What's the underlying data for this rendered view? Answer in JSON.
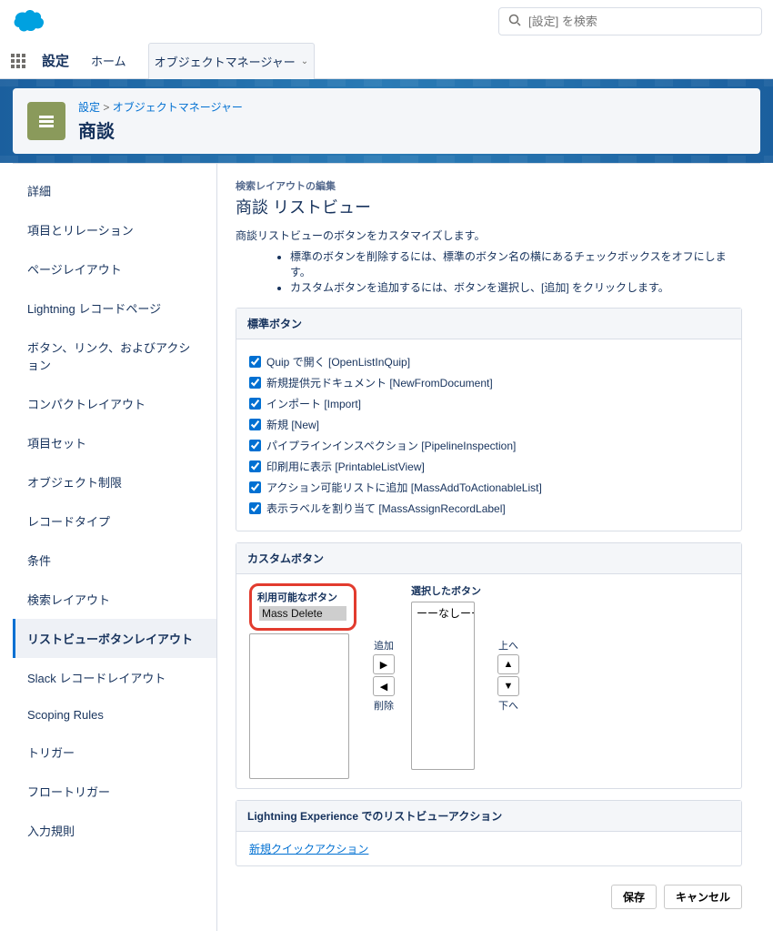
{
  "search": {
    "placeholder": "[設定] を検索"
  },
  "nav": {
    "title": "設定",
    "home": "ホーム",
    "objmgr": "オブジェクトマネージャー"
  },
  "breadcrumb": {
    "a": "設定",
    "b": "オブジェクトマネージャー"
  },
  "page": {
    "title": "商談"
  },
  "sidebar": {
    "items": [
      "詳細",
      "項目とリレーション",
      "ページレイアウト",
      "Lightning レコードページ",
      "ボタン、リンク、およびアクション",
      "コンパクトレイアウト",
      "項目セット",
      "オブジェクト制限",
      "レコードタイプ",
      "条件",
      "検索レイアウト",
      "リストビューボタンレイアウト",
      "Slack レコードレイアウト",
      "Scoping Rules",
      "トリガー",
      "フロートリガー",
      "入力規則"
    ],
    "activeIndex": 11
  },
  "main": {
    "edit_label": "検索レイアウトの編集",
    "title": "商談 リストビュー",
    "desc": "商談リストビューのボタンをカスタマイズします。",
    "hints": [
      "標準のボタンを削除するには、標準のボタン名の横にあるチェックボックスをオフにします。",
      "カスタムボタンを追加するには、ボタンを選択し、[追加] をクリックします。"
    ]
  },
  "sections": {
    "standard": {
      "title": "標準ボタン",
      "items": [
        "Quip で開く [OpenListInQuip]",
        "新規提供元ドキュメント [NewFromDocument]",
        "インポート [Import]",
        "新規 [New]",
        "パイプラインインスペクション [PipelineInspection]",
        "印刷用に表示 [PrintableListView]",
        "アクション可能リストに追加 [MassAddToActionableList]",
        "表示ラベルを割り当て [MassAssignRecordLabel]"
      ]
    },
    "custom": {
      "title": "カスタムボタン",
      "available_label": "利用可能なボタン",
      "selected_label": "選択したボタン",
      "available": [
        "Mass Delete"
      ],
      "selected_placeholder": "ーーなしーー",
      "add": "追加",
      "remove": "削除",
      "up": "上へ",
      "down": "下へ"
    },
    "lex": {
      "title": "Lightning Experience でのリストビューアクション",
      "link": "新規クイックアクション"
    }
  },
  "footer": {
    "save": "保存",
    "cancel": "キャンセル"
  }
}
